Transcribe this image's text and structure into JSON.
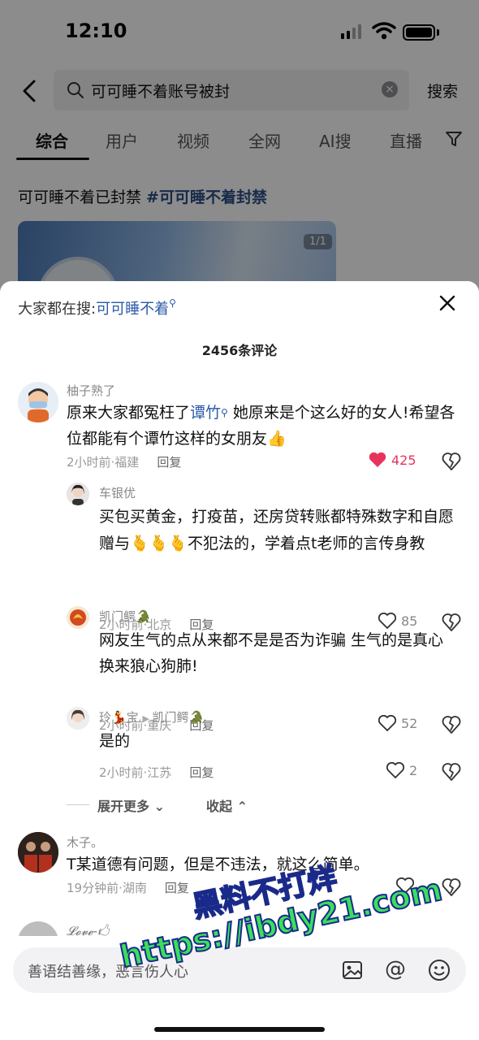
{
  "status_bar": {
    "time": "12:10"
  },
  "search": {
    "query": "可可睡不着账号被封",
    "button_label": "搜索"
  },
  "tabs": [
    {
      "label": "综合"
    },
    {
      "label": "用户"
    },
    {
      "label": "视频"
    },
    {
      "label": "全网"
    },
    {
      "label": "AI搜"
    },
    {
      "label": "直播"
    }
  ],
  "background_post": {
    "text": "可可睡不着已封禁 ",
    "hashtag": "#可可睡不着封禁",
    "image_badge": "1/1"
  },
  "sheet": {
    "search_prefix": "大家都在搜:",
    "search_term": "可可睡不着",
    "comment_count_label": "2456条评论"
  },
  "comments": [
    {
      "user": "柚子熟了",
      "text_a": "原来大家都冤枉了",
      "mention": "谭竹",
      "text_b": " 她原来是个这么好的女人!希望各位都能有个谭竹这样的女朋友👍",
      "meta": "2小时前·福建",
      "reply": "回复",
      "likes": "425",
      "liked": true
    },
    {
      "user": "车银优",
      "text": "买包买黄金，打疫苗，还房贷转账都特殊数字和自愿赠与🫰🫰🫰不犯法的，学着点t老师的言传身教",
      "meta": "2小时前·北京",
      "reply": "回复",
      "likes": "85"
    },
    {
      "user": "凯门鳄🐊",
      "text": "网友生气的点从来都不是是否为诈骗  生气的是真心换来狼心狗肺!",
      "meta": "2小时前·重庆",
      "reply": "回复",
      "likes": "52"
    },
    {
      "user": "玲💃宝",
      "reply_to": "凯门鳄🐊",
      "text": "是的",
      "meta": "2小时前·江苏",
      "reply": "回复",
      "likes": "2"
    },
    {
      "user": "木子。",
      "text": "T某道德有问题，但是不违法，就这么简单。",
      "meta": "19分钟前·湖南",
      "reply": "回复",
      "likes": ""
    },
    {
      "user": "𝓛𝓸𝓿𝓮-🖒"
    }
  ],
  "expand_label": "展开更多",
  "collapse_label": "收起",
  "input": {
    "placeholder": "善语结善缘，恶言伤人心"
  },
  "watermark": {
    "line1": "黑料不打烊",
    "line2": "https://ibdy21.com"
  },
  "colors": {
    "link": "#2b5aa8",
    "like_active": "#e8345d",
    "watermark": "#3adf5b"
  }
}
